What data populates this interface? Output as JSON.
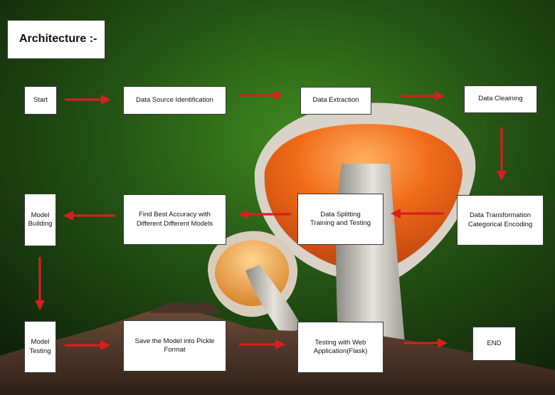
{
  "title": "Architecture :-",
  "nodes": {
    "start": "Start",
    "data_source": "Data Source Identification",
    "data_extraction": "Data Extraction",
    "data_cleaning": "Data Cleaining",
    "data_transformation": "Data Transformation\nCategorical Encoding",
    "data_splitting": "Data Splitting\nTraining and Testing",
    "best_accuracy": "Find Best Accuracy with\nDifferent Different Models",
    "model_building": "Model\nBuilding",
    "model_testing": "Model\nTesting",
    "save_model": "Save the Model into Pickle\nFormat",
    "web_testing": "Testing with Web\nApplication(Flask)",
    "end": "END"
  },
  "colors": {
    "arrow": "#d71f1f",
    "box": "#ffffff"
  },
  "background": "mushroom photograph on green background"
}
